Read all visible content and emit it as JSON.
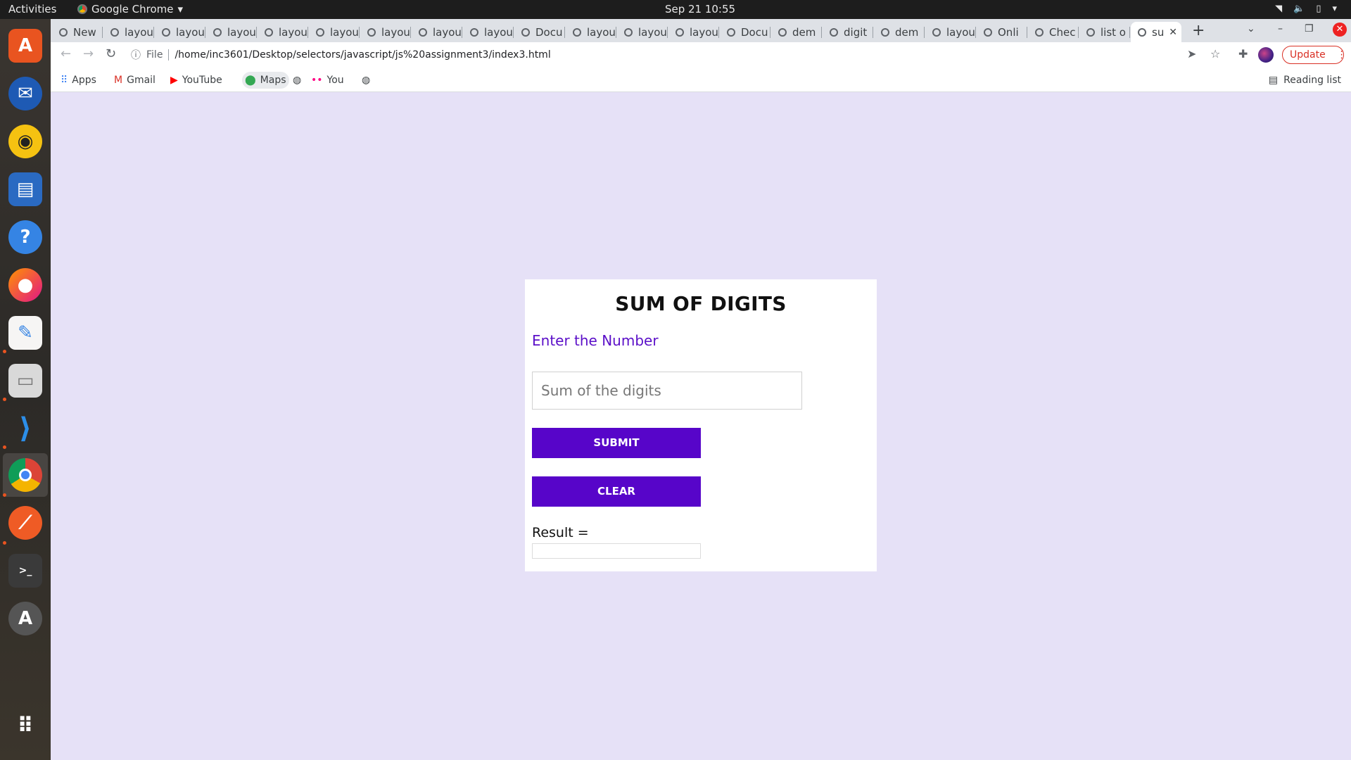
{
  "topbar": {
    "activities": "Activities",
    "app_name": "Google Chrome",
    "clock": "Sep 21  10:55"
  },
  "dock": {
    "items": [
      "ubuntu-software",
      "thunderbird",
      "rhythmbox",
      "libreoffice-writer",
      "help",
      "firefox",
      "text-editor",
      "files",
      "vscode",
      "chrome",
      "postman",
      "terminal",
      "software-updater",
      "show-applications"
    ]
  },
  "browser": {
    "tabs": [
      "New",
      "layou",
      "layou",
      "layou",
      "layou",
      "layou",
      "layou",
      "layou",
      "layou",
      "Docu",
      "layou",
      "layou",
      "layou",
      "Docu",
      "dem",
      "digit",
      "dem",
      "layou",
      "Onli",
      "Chec",
      "list o",
      "su"
    ],
    "active_tab_index": 21,
    "address": {
      "scheme_label": "File",
      "url": "/home/inc3601/Desktop/selectors/javascript/js%20assignment3/index3.html"
    },
    "update_label": "Update",
    "bookmarks": [
      {
        "label": "Apps",
        "icon": "apps-grid-icon"
      },
      {
        "label": "Gmail",
        "icon": "gmail-icon"
      },
      {
        "label": "YouTube",
        "icon": "youtube-icon"
      },
      {
        "label": "Maps",
        "icon": "maps-icon"
      },
      {
        "label": "",
        "icon": "globe-icon"
      },
      {
        "label": "You",
        "icon": "flickr-icon"
      },
      {
        "label": "",
        "icon": "globe-icon"
      }
    ],
    "reading_list_label": "Reading list"
  },
  "page": {
    "title": "SUM OF DIGITS",
    "input_label": "Enter the Number",
    "input_placeholder": "Sum of the digits",
    "input_value": "",
    "submit_label": "SUBMIT",
    "clear_label": "CLEAR",
    "result_label": "Result =",
    "result_value": "",
    "colors": {
      "background": "#e6e1f7",
      "accent": "#5705c9",
      "label": "#5b0fc8"
    }
  }
}
